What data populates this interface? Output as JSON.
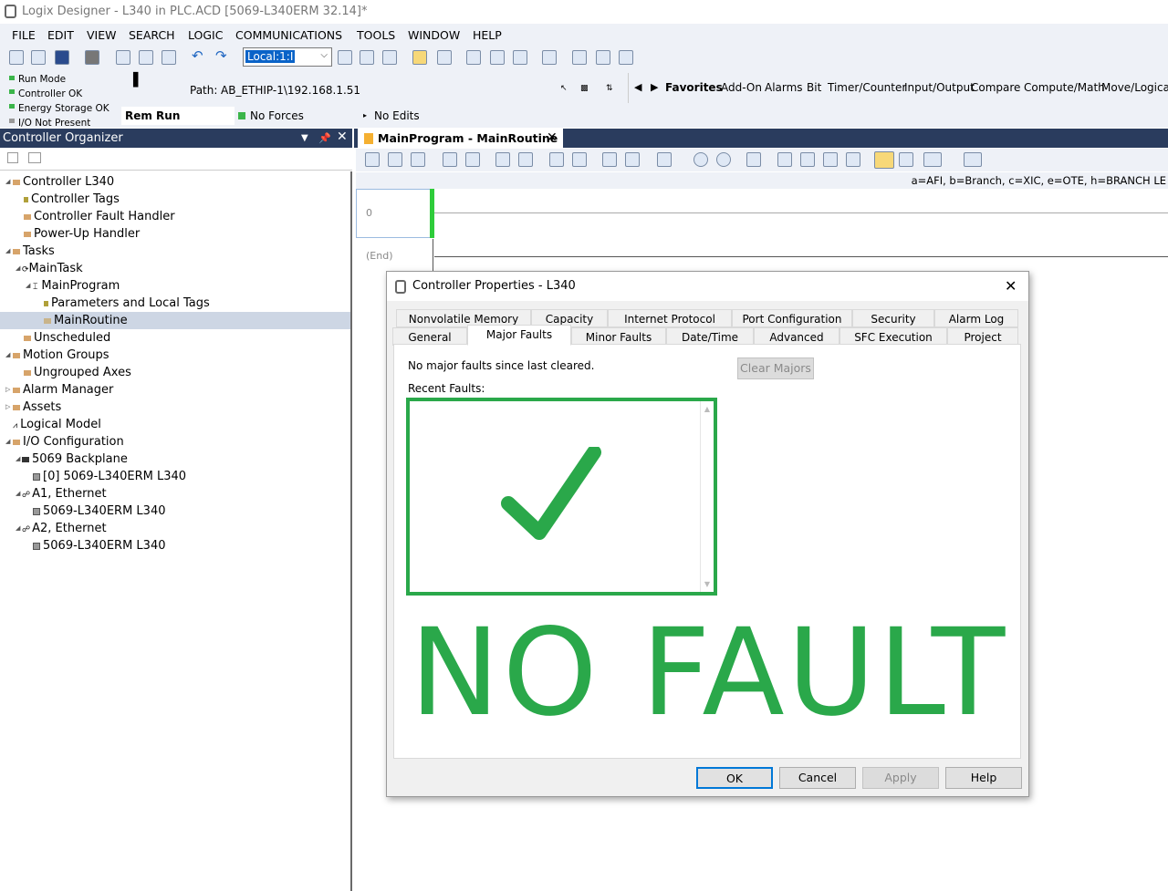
{
  "window": {
    "title": "Logix Designer - L340 in PLC.ACD [5069-L340ERM 32.14]*"
  },
  "menu": [
    "FILE",
    "EDIT",
    "VIEW",
    "SEARCH",
    "LOGIC",
    "COMMUNICATIONS",
    "TOOLS",
    "WINDOW",
    "HELP"
  ],
  "toolbar": {
    "path_value": "Local:1:I"
  },
  "status": {
    "run_mode": "Run Mode",
    "controller_ok": "Controller OK",
    "energy_storage": "Energy Storage OK",
    "io": "I/O Not Present",
    "path_label": "Path:",
    "path_value": "AB_ETHIP-1\\192.168.1.51",
    "rem_run": "Rem Run",
    "no_forces": "No Forces",
    "no_edits": "No Edits"
  },
  "instruction_tabs": [
    "Favorites",
    "Add-On",
    "Alarms",
    "Bit",
    "Timer/Counter",
    "Input/Output",
    "Compare",
    "Compute/Math",
    "Move/Logical"
  ],
  "organizer": {
    "title": "Controller Organizer",
    "items": [
      {
        "label": "Controller L340"
      },
      {
        "label": "Controller Tags"
      },
      {
        "label": "Controller Fault Handler"
      },
      {
        "label": "Power-Up Handler"
      },
      {
        "label": "Tasks"
      },
      {
        "label": "MainTask"
      },
      {
        "label": "MainProgram"
      },
      {
        "label": "Parameters and Local Tags"
      },
      {
        "label": "MainRoutine"
      },
      {
        "label": "Unscheduled"
      },
      {
        "label": "Motion Groups"
      },
      {
        "label": "Ungrouped Axes"
      },
      {
        "label": "Alarm Manager"
      },
      {
        "label": "Assets"
      },
      {
        "label": "Logical Model"
      },
      {
        "label": "I/O Configuration"
      },
      {
        "label": "5069 Backplane"
      },
      {
        "label": "[0] 5069-L340ERM L340"
      },
      {
        "label": "A1, Ethernet"
      },
      {
        "label": "5069-L340ERM L340"
      },
      {
        "label": "A2, Ethernet"
      },
      {
        "label": "5069-L340ERM L340"
      }
    ]
  },
  "editor": {
    "tab_title": "MainProgram - MainRoutine",
    "hint": "a=AFI, b=Branch, c=XIC, e=OTE, h=BRANCH LE",
    "rung_number": "0",
    "end_label": "(End)"
  },
  "dialog": {
    "title": "Controller Properties - L340",
    "tabs_row1": [
      "Nonvolatile Memory",
      "Capacity",
      "Internet Protocol",
      "Port Configuration",
      "Security",
      "Alarm Log"
    ],
    "tabs_row2": [
      "General",
      "Major Faults",
      "Minor Faults",
      "Date/Time",
      "Advanced",
      "SFC Execution",
      "Project"
    ],
    "status_text": "No major faults since last cleared.",
    "clear_button": "Clear Majors",
    "recent_label": "Recent Faults:",
    "overlay_text": "NO FAULT",
    "overlay_color": "#2aa84a",
    "buttons": {
      "ok": "OK",
      "cancel": "Cancel",
      "apply": "Apply",
      "help": "Help"
    }
  }
}
